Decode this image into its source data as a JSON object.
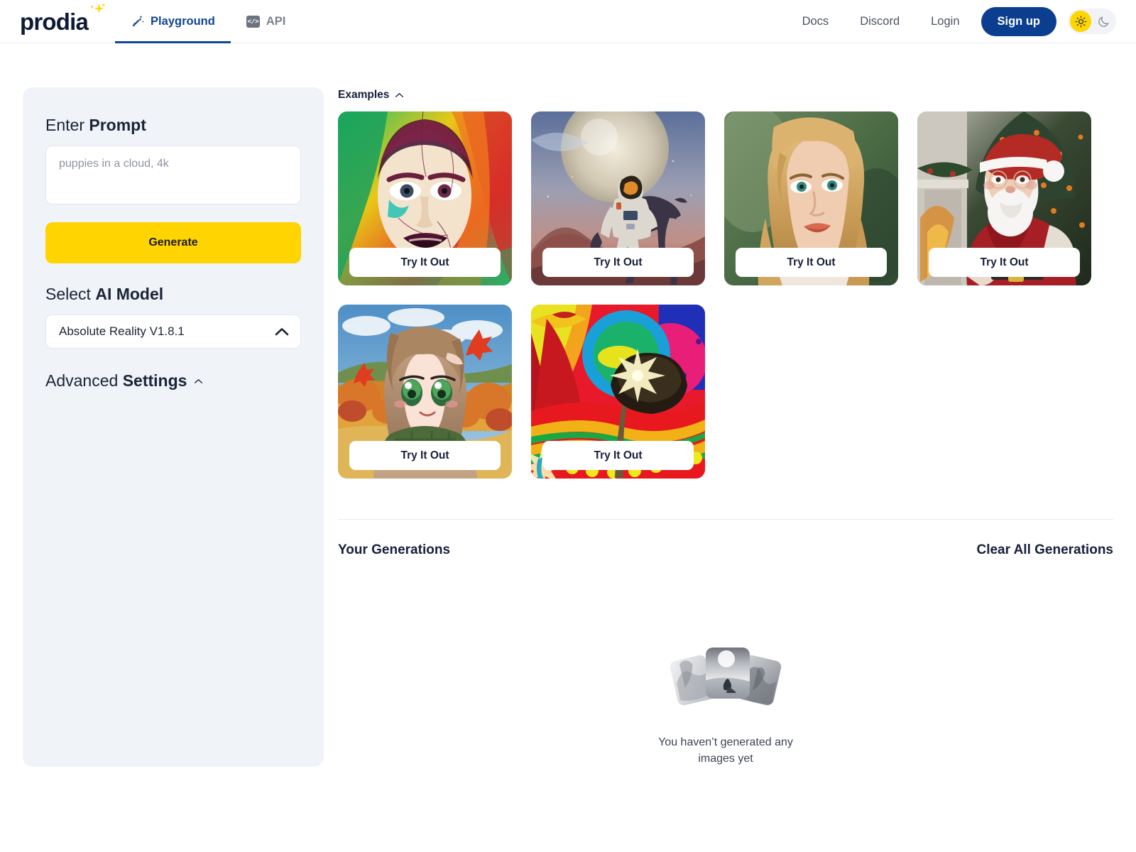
{
  "header": {
    "logo_text": "prodia",
    "logo_sparkle_icon": "sparkle-icon",
    "tabs": [
      {
        "label": "Playground",
        "icon": "magic-wand-icon",
        "active": true
      },
      {
        "label": "API",
        "icon": "code-brackets-icon",
        "active": false
      }
    ],
    "links": [
      {
        "label": "Docs"
      },
      {
        "label": "Discord"
      },
      {
        "label": "Login"
      }
    ],
    "signup_label": "Sign up",
    "theme_toggle": {
      "light_icon": "sun-icon",
      "dark_icon": "moon-icon",
      "active": "light",
      "active_color": "#ffd600",
      "track_color": "#f1f3f7"
    },
    "accent_color": "#114696"
  },
  "sidebar": {
    "prompt_label_prefix": "Enter ",
    "prompt_label_strong": "Prompt",
    "prompt_value": "",
    "prompt_placeholder": "puppies in a cloud, 4k",
    "generate_label": "Generate",
    "generate_color": "#ffd400",
    "model_label_prefix": "Select ",
    "model_label_strong": "AI Model",
    "model_selected": "Absolute Reality V1.8.1",
    "model_chevron_icon": "chevron-up-icon",
    "advanced_label_prefix": "Advanced ",
    "advanced_label_strong": "Settings",
    "advanced_chevron_icon": "chevron-up-icon",
    "panel_color": "#f0f3f7"
  },
  "examples": {
    "title": "Examples",
    "collapse_icon": "chevron-up-icon",
    "cards": [
      {
        "name": "colorful-painted-woman-portrait",
        "try_label": "Try It Out"
      },
      {
        "name": "astronaut-on-horse-planet",
        "try_label": "Try It Out"
      },
      {
        "name": "blonde-woman-photo-portrait",
        "try_label": "Try It Out"
      },
      {
        "name": "santa-claus-christmas-tree",
        "try_label": "Try It Out"
      },
      {
        "name": "anime-girl-autumn-scarf",
        "try_label": "Try It Out"
      },
      {
        "name": "psychedelic-mushroom-landscape",
        "try_label": "Try It Out"
      }
    ]
  },
  "generations": {
    "title": "Your Generations",
    "clear_label": "Clear All Generations",
    "empty_icon": "stacked-photos-icon",
    "empty_text": "You haven’t generated any images yet"
  }
}
